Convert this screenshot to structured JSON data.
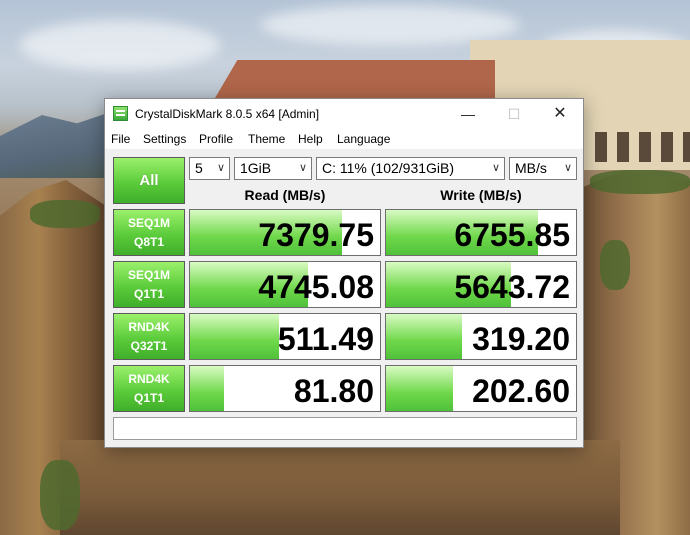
{
  "window": {
    "title": "CrystalDiskMark 8.0.5 x64 [Admin]",
    "minimize": "—",
    "maximize": "☐",
    "close": "✕"
  },
  "menu": [
    "File",
    "Settings",
    "Profile",
    "Theme",
    "Help",
    "Language"
  ],
  "controls": {
    "all_button": "All",
    "test_count": "5",
    "test_size": "1GiB",
    "drive": "C: 11% (102/931GiB)",
    "unit": "MB/s"
  },
  "headers": {
    "read": "Read (MB/s)",
    "write": "Write (MB/s)"
  },
  "rows": [
    {
      "line1": "SEQ1M",
      "line2": "Q8T1",
      "read": "7379.75",
      "write": "6755.85",
      "read_fill": 0.8,
      "write_fill": 0.8
    },
    {
      "line1": "SEQ1M",
      "line2": "Q1T1",
      "read": "4745.08",
      "write": "5643.72",
      "read_fill": 0.62,
      "write_fill": 0.66
    },
    {
      "line1": "RND4K",
      "line2": "Q32T1",
      "read": "511.49",
      "write": "319.20",
      "read_fill": 0.47,
      "write_fill": 0.4
    },
    {
      "line1": "RND4K",
      "line2": "Q1T1",
      "read": "81.80",
      "write": "202.60",
      "read_fill": 0.18,
      "write_fill": 0.35
    }
  ],
  "comment": "",
  "colors": {
    "accent_green": "#5ccc3b",
    "bar_green": "#6fd84a"
  }
}
